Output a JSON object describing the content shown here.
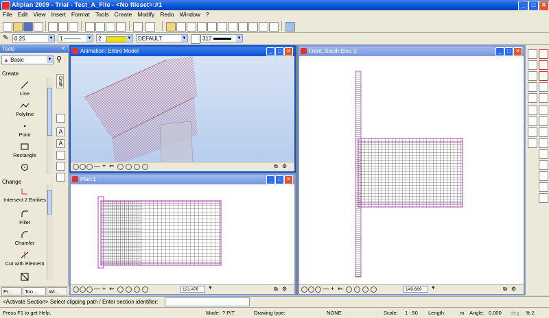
{
  "window": {
    "title": "Allplan 2009 - Trial - Test_A_File - <No fileset>:#1",
    "min_label": "_",
    "max_label": "□",
    "close_label": "✕"
  },
  "menu": [
    "File",
    "Edit",
    "View",
    "Insert",
    "Format",
    "Tools",
    "Create",
    "Modify",
    "Redo",
    "Window",
    "?"
  ],
  "format_bar": {
    "pen": "0.25",
    "line": "1",
    "color": "2",
    "layer": "DEFAULT",
    "linetype_number": "317"
  },
  "palette": {
    "header": "Tools",
    "selector": "Basic",
    "group_create": "Create",
    "group_change": "Change",
    "side_tab": "Draft",
    "tools_create": [
      "Line",
      "Polyline",
      "Point",
      "Rectangle"
    ],
    "tools_change": [
      "Intersect 2 Entities",
      "Fillet",
      "Chamfer",
      "Cut with Element"
    ],
    "tabs": [
      "Pr...",
      "Too...",
      "Wi..."
    ]
  },
  "viewports": {
    "animation": {
      "title": "Animation: Entire Model"
    },
    "plan": {
      "title": "Plan:1",
      "scale": "121.476"
    },
    "front": {
      "title": "Front, South Elev.:2",
      "scale": "149.669"
    }
  },
  "dialog": {
    "prompt": "<Activate Section> Select clipping path / Enter section identifier:",
    "input_value": ""
  },
  "status": {
    "help": "Press F1 to get Help.",
    "mode_label": "Mode:",
    "mode_value": "? P/T",
    "drawing_type_label": "Drawing type:",
    "drawing_type_value": "NONE",
    "scale_label": "Scale:",
    "scale_value": "1 : 50",
    "length_label": "Length:",
    "length_unit": "m",
    "angle_label": "Angle:",
    "angle_value": "0.000",
    "angle_unit": "deg",
    "percent_value": "% 2"
  },
  "colors": {
    "titlebar": "#0a52d8",
    "layer_color": "#f0e000",
    "wire_red": "#c0506a",
    "wire_magenta": "#b040b0"
  }
}
